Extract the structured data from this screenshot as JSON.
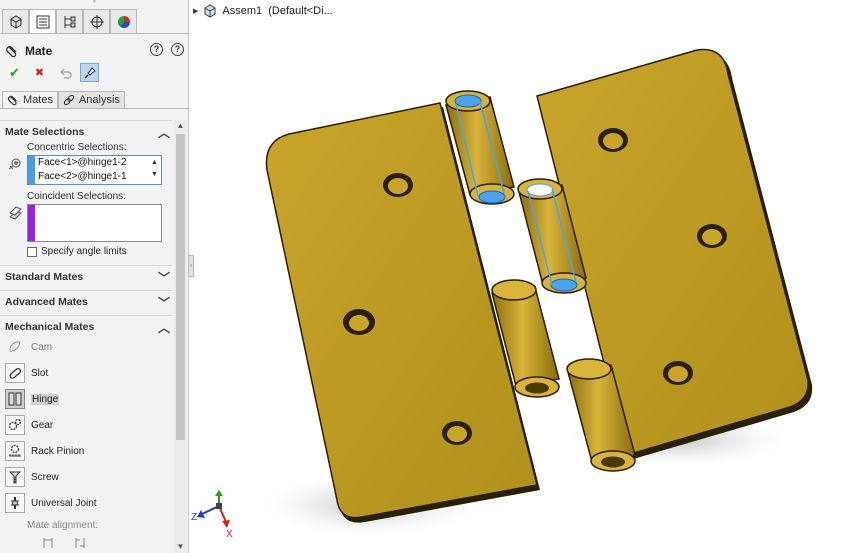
{
  "manager_tabs": [
    {
      "icon": "feature-manager-icon"
    },
    {
      "icon": "property-manager-icon"
    },
    {
      "icon": "configuration-manager-icon"
    },
    {
      "icon": "dimxpert-manager-icon"
    },
    {
      "icon": "display-manager-icon"
    }
  ],
  "property_manager": {
    "title": "Mate",
    "help_label": "?",
    "help2_label": "?",
    "ok_glyph": "✔",
    "cancel_glyph": "✖",
    "tabs": [
      {
        "label": "Mates",
        "icon": "paperclip-icon",
        "active": true
      },
      {
        "label": "Analysis",
        "icon": "link-icon",
        "active": false
      }
    ]
  },
  "mate_selections": {
    "header": "Mate Selections",
    "concentric_label": "Concentric Selections:",
    "concentric_items": [
      "Face<1>@hinge1-2",
      "Face<2>@hinge1-1"
    ],
    "concentric_color": "#4a9bea",
    "coincident_label": "Coincident Selections:",
    "coincident_items": [],
    "coincident_color": "#9b1fe8",
    "angle_limits_label": "Specify angle limits",
    "angle_limits_checked": false
  },
  "sections": {
    "standard": "Standard Mates",
    "advanced": "Advanced Mates",
    "mechanical": "Mechanical Mates"
  },
  "mechanical_mates": [
    {
      "label": "Cam",
      "icon": "cam-icon",
      "selected": false,
      "dim": true
    },
    {
      "label": "Slot",
      "icon": "slot-icon",
      "selected": false,
      "dim": false
    },
    {
      "label": "Hinge",
      "icon": "hinge-icon",
      "selected": true,
      "dim": false
    },
    {
      "label": "Gear",
      "icon": "gear-icon",
      "selected": false,
      "dim": false
    },
    {
      "label": "Rack Pinion",
      "icon": "rack-pinion-icon",
      "selected": false,
      "dim": false
    },
    {
      "label": "Screw",
      "icon": "screw-icon",
      "selected": false,
      "dim": false
    },
    {
      "label": "Universal Joint",
      "icon": "universal-joint-icon",
      "selected": false,
      "dim": false
    }
  ],
  "mate_alignment_label": "Mate alignment:",
  "tree_flyout": {
    "text": "Assem1  (Default<Di..."
  },
  "triad": {
    "x": "X",
    "z": "Z"
  },
  "colors": {
    "part": "#b5921e",
    "part_edge": "#3a2a00",
    "highlight": "#4aa3f0",
    "panel_bg": "#f3f3f3"
  }
}
